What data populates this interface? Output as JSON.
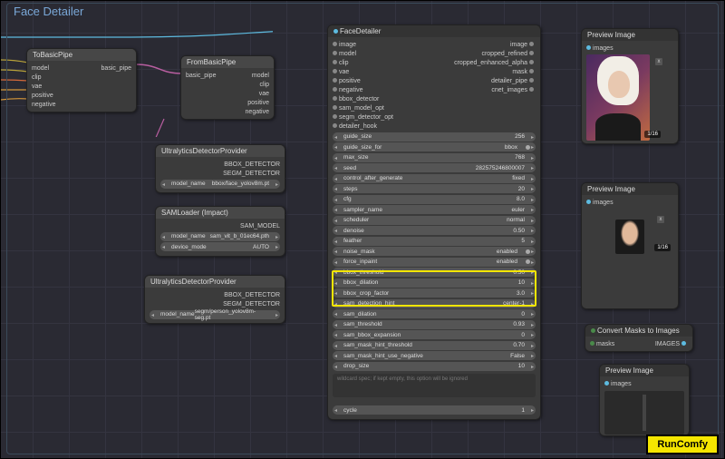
{
  "group": {
    "title": "Face Detailer"
  },
  "nodes": {
    "toBasicPipe": {
      "title": "ToBasicPipe",
      "inputs": [
        "model",
        "clip",
        "vae",
        "positive",
        "negative"
      ],
      "outputs": [
        "basic_pipe"
      ]
    },
    "fromBasicPipe": {
      "title": "FromBasicPipe",
      "inputs": [
        "basic_pipe"
      ],
      "outputs": [
        "model",
        "clip",
        "vae",
        "positive",
        "negative"
      ]
    },
    "ultra1": {
      "title": "UltralyticsDetectorProvider",
      "outputs": [
        "BBOX_DETECTOR",
        "SEGM_DETECTOR"
      ],
      "model_label": "model_name",
      "model_value": "bbox/face_yolov8m.pt"
    },
    "sam": {
      "title": "SAMLoader (Impact)",
      "outputs": [
        "SAM_MODEL"
      ],
      "rows": [
        {
          "label": "model_name",
          "value": "sam_vit_b_01ec64.pth"
        },
        {
          "label": "device_mode",
          "value": "AUTO"
        }
      ]
    },
    "ultra2": {
      "title": "UltralyticsDetectorProvider",
      "outputs": [
        "BBOX_DETECTOR",
        "SEGM_DETECTOR"
      ],
      "model_label": "model_name",
      "model_value": "segm/person_yolov8m-seg.pt"
    },
    "faceDetailer": {
      "title": "FaceDetailer",
      "inputs": [
        "image",
        "model",
        "clip",
        "vae",
        "positive",
        "negative",
        "bbox_detector",
        "sam_model_opt",
        "segm_detector_opt",
        "detailer_hook"
      ],
      "outputs": [
        "image",
        "cropped_refined",
        "cropped_enhanced_alpha",
        "mask",
        "detailer_pipe",
        "cnet_images"
      ],
      "params": [
        {
          "label": "guide_size",
          "value": "256"
        },
        {
          "label": "guide_size_for",
          "value": "bbox",
          "dot": true
        },
        {
          "label": "max_size",
          "value": "768"
        },
        {
          "label": "seed",
          "value": "282575246800007"
        },
        {
          "label": "control_after_generate",
          "value": "fixed"
        },
        {
          "label": "steps",
          "value": "20"
        },
        {
          "label": "cfg",
          "value": "8.0"
        },
        {
          "label": "sampler_name",
          "value": "euler"
        },
        {
          "label": "scheduler",
          "value": "normal"
        },
        {
          "label": "denoise",
          "value": "0.50"
        },
        {
          "label": "feather",
          "value": "5"
        },
        {
          "label": "noise_mask",
          "value": "enabled",
          "dot": true
        },
        {
          "label": "force_inpaint",
          "value": "enabled",
          "dot": true
        },
        {
          "label": "bbox_threshold",
          "value": "0.50"
        },
        {
          "label": "bbox_dilation",
          "value": "10"
        },
        {
          "label": "bbox_crop_factor",
          "value": "3.0"
        },
        {
          "label": "sam_detection_hint",
          "value": "center-1"
        },
        {
          "label": "sam_dilation",
          "value": "0"
        },
        {
          "label": "sam_threshold",
          "value": "0.93"
        },
        {
          "label": "sam_bbox_expansion",
          "value": "0"
        },
        {
          "label": "sam_mask_hint_threshold",
          "value": "0.70"
        },
        {
          "label": "sam_mask_hint_use_negative",
          "value": "False"
        },
        {
          "label": "drop_size",
          "value": "10"
        }
      ],
      "wildcard": "wildcard spec; if kept empty, this option will be ignored",
      "cycle": {
        "label": "cycle",
        "value": "1"
      }
    },
    "preview1": {
      "title": "Preview Image",
      "inputs": [
        "images"
      ],
      "counter": "1/16"
    },
    "preview2": {
      "title": "Preview Image",
      "inputs": [
        "images"
      ],
      "counter": "1/16"
    },
    "convert": {
      "title": "Convert Masks to Images",
      "in": "masks",
      "out": "IMAGES"
    },
    "preview3": {
      "title": "Preview Image",
      "inputs": [
        "images"
      ]
    }
  },
  "brand": "RunComfy"
}
